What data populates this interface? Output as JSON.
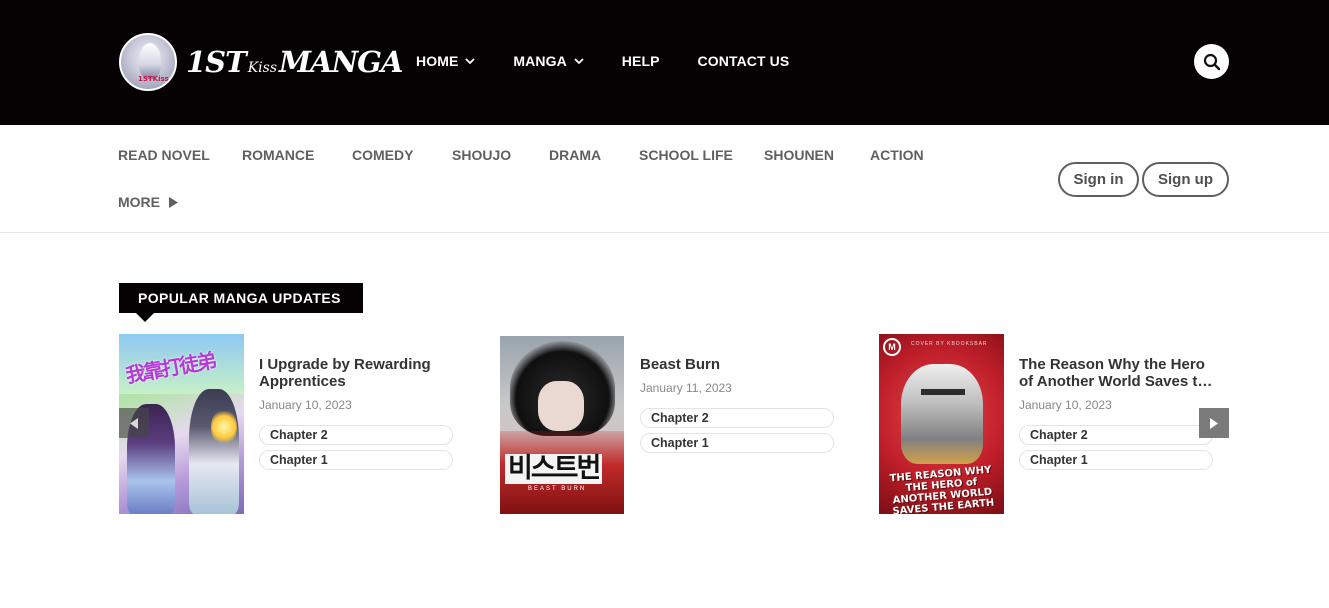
{
  "header": {
    "logo": {
      "text_main": "1ST",
      "text_small": "Kiss",
      "text_end": "MANGA",
      "badge_text": "1STKiss"
    },
    "nav": [
      {
        "label": "HOME",
        "has_dropdown": true
      },
      {
        "label": "MANGA",
        "has_dropdown": true
      },
      {
        "label": "HELP",
        "has_dropdown": false
      },
      {
        "label": "CONTACT US",
        "has_dropdown": false
      }
    ],
    "search_icon": "search-icon"
  },
  "genres": {
    "items": [
      "READ NOVEL",
      "ROMANCE",
      "COMEDY",
      "SHOUJO",
      "DRAMA",
      "SCHOOL LIFE",
      "SHOUNEN",
      "ACTION"
    ],
    "more_label": "MORE"
  },
  "auth": {
    "sign_in": "Sign in",
    "sign_up": "Sign up"
  },
  "popular": {
    "heading": "POPULAR MANGA UPDATES",
    "cards": [
      {
        "title": "I Upgrade by Rewarding Apprentices",
        "date": "January 10, 2023",
        "chapters": [
          "Chapter 2",
          "Chapter 1"
        ],
        "cover_text": "我靠打徒弟"
      },
      {
        "title": "Beast Burn",
        "date": "January 11, 2023",
        "chapters": [
          "Chapter 2",
          "Chapter 1"
        ],
        "cover_text": "비스트번",
        "cover_sub": "BEAST BURN"
      },
      {
        "title": "The Reason Why the Hero of Another World Saves the Earth",
        "date": "January 10, 2023",
        "chapters": [
          "Chapter 2",
          "Chapter 1"
        ],
        "cover_text": "THE REASON WHY THE HERO of ANOTHER WORLD SAVES THE EARTH",
        "cover_credit": "COVER BY KBOOKSBAR",
        "cover_logo": "M"
      }
    ]
  },
  "colors": {
    "header_bg": "#060103",
    "genre_text": "#606060",
    "heading_bg": "#060103"
  }
}
